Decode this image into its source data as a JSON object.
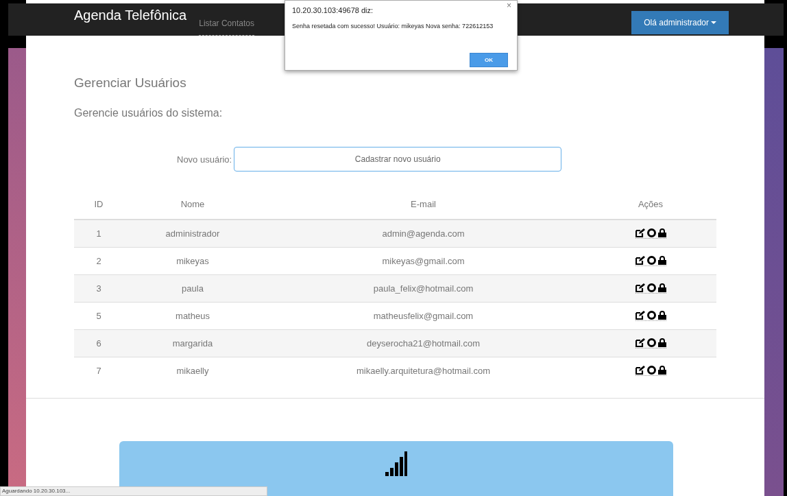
{
  "navbar": {
    "brand": "Agenda Telefônica",
    "links": [
      {
        "label": "Listar Contatos",
        "selected": false
      }
    ],
    "user_menu": "Olá administrador"
  },
  "dialog": {
    "title": "10.20.30.103:49678 diz:",
    "message": "Senha resetada com sucesso! Usuário: mikeyas Nova senha: 722612153",
    "button": "OK",
    "close": "×"
  },
  "page": {
    "title": "Gerenciar Usuários",
    "subtitle": "Gerencie usuários do sistema:"
  },
  "new_user": {
    "label": "Novo usuário:",
    "placeholder": "Cadastrar novo usuário"
  },
  "table": {
    "columns": [
      "ID",
      "Nome",
      "E-mail",
      "Ações"
    ],
    "rows": [
      {
        "id": "1",
        "name": "administrador",
        "email": "admin@agenda.com"
      },
      {
        "id": "2",
        "name": "mikeyas",
        "email": "mikeyas@gmail.com"
      },
      {
        "id": "3",
        "name": "paula",
        "email": "paula_felix@hotmail.com"
      },
      {
        "id": "5",
        "name": "matheus",
        "email": "matheusfelix@gmail.com"
      },
      {
        "id": "6",
        "name": "margarida",
        "email": "deyserocha21@hotmail.com"
      },
      {
        "id": "7",
        "name": "mikaelly",
        "email": "mikaelly.arquitetura@hotmail.com"
      }
    ]
  },
  "status_bar": "Aguardando 10.20.30.103..."
}
